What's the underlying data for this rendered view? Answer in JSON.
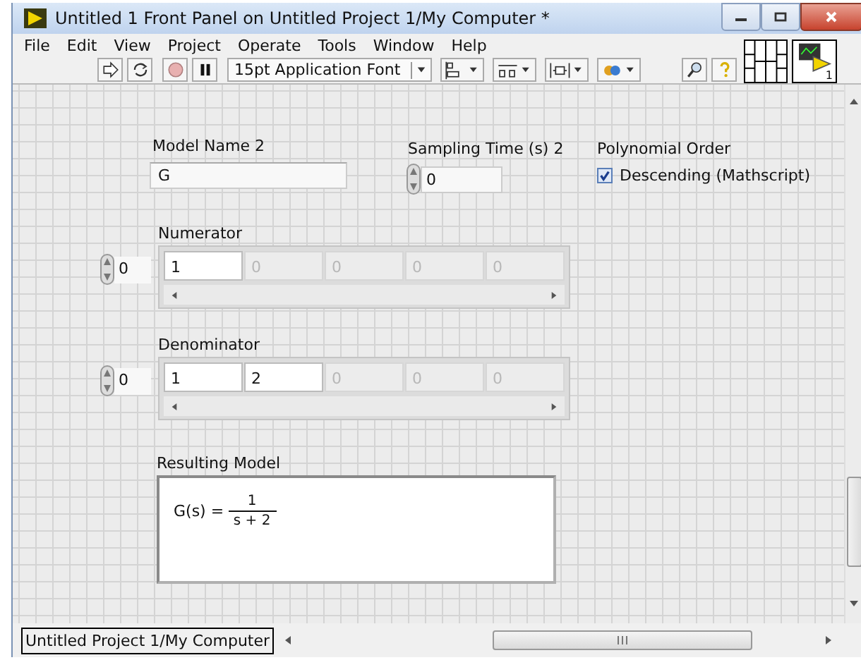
{
  "window": {
    "title": "Untitled 1 Front Panel on Untitled Project 1/My Computer *"
  },
  "menu": [
    {
      "label": "File"
    },
    {
      "label": "Edit"
    },
    {
      "label": "View"
    },
    {
      "label": "Project"
    },
    {
      "label": "Operate"
    },
    {
      "label": "Tools"
    },
    {
      "label": "Window"
    },
    {
      "label": "Help"
    }
  ],
  "toolbar": {
    "font": "15pt Application Font"
  },
  "connector_pane": {
    "terminal": "1"
  },
  "controls": {
    "model_name": {
      "label": "Model Name 2",
      "value": "G"
    },
    "sampling_time": {
      "label": "Sampling Time (s) 2",
      "value": "0"
    },
    "polynomial_order": {
      "label": "Polynomial Order",
      "option": {
        "label": "Descending (Mathscript)",
        "checked": true
      }
    },
    "arrays": [
      {
        "label": "Numerator",
        "index": "0",
        "elements": [
          {
            "value": "1",
            "filled": true
          },
          {
            "value": "0",
            "filled": false
          },
          {
            "value": "0",
            "filled": false
          },
          {
            "value": "0",
            "filled": false
          },
          {
            "value": "0",
            "filled": false
          }
        ]
      },
      {
        "label": "Denominator",
        "index": "0",
        "elements": [
          {
            "value": "1",
            "filled": true
          },
          {
            "value": "2",
            "filled": true
          },
          {
            "value": "0",
            "filled": false
          },
          {
            "value": "0",
            "filled": false
          },
          {
            "value": "0",
            "filled": false
          }
        ]
      }
    ],
    "resulting_model": {
      "label": "Resulting Model",
      "lhs": "G(s) =",
      "numerator": "1",
      "denominator": "s + 2"
    }
  },
  "status_bar": {
    "context": "Untitled Project 1/My Computer"
  }
}
